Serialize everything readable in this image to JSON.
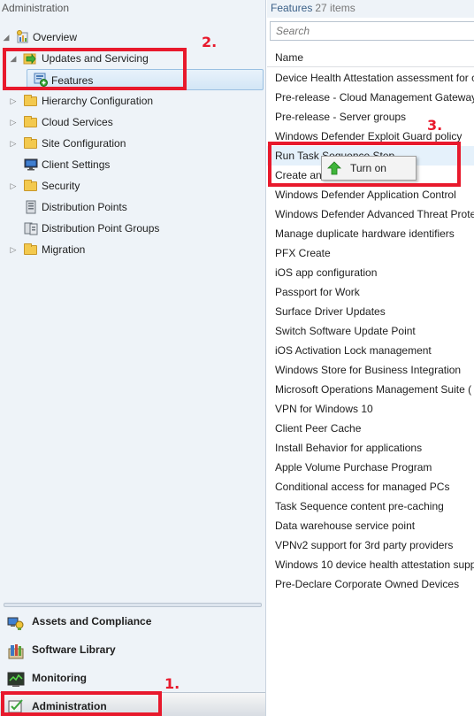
{
  "left_pane": {
    "title": "Administration",
    "tree": [
      {
        "label": "Overview",
        "icon": "overview-icon",
        "expander": "◢"
      },
      {
        "label": "Updates and Servicing",
        "icon": "updates-servicing-icon",
        "expander": "◢"
      },
      {
        "label": "Features",
        "icon": "features-icon",
        "expander": ""
      },
      {
        "label": "Hierarchy Configuration",
        "icon": "folder-icon",
        "expander": "▷"
      },
      {
        "label": "Cloud Services",
        "icon": "folder-icon",
        "expander": "▷"
      },
      {
        "label": "Site Configuration",
        "icon": "folder-icon",
        "expander": "▷"
      },
      {
        "label": "Client Settings",
        "icon": "monitor-icon",
        "expander": ""
      },
      {
        "label": "Security",
        "icon": "folder-icon",
        "expander": "▷"
      },
      {
        "label": "Distribution Points",
        "icon": "distribution-icon",
        "expander": ""
      },
      {
        "label": "Distribution Point Groups",
        "icon": "distribution-icon",
        "expander": ""
      },
      {
        "label": "Migration",
        "icon": "folder-icon",
        "expander": "▷"
      }
    ],
    "workspaces": [
      {
        "label": "Assets and Compliance",
        "icon": "assets-icon"
      },
      {
        "label": "Software Library",
        "icon": "software-library-icon"
      },
      {
        "label": "Monitoring",
        "icon": "monitoring-icon"
      },
      {
        "label": "Administration",
        "icon": "administration-icon"
      }
    ]
  },
  "right_pane": {
    "title": "Features",
    "count": "27 items",
    "search_placeholder": "Search",
    "column_header": "Name",
    "rows": [
      "Device Health Attestation assessment for c",
      "Pre-release - Cloud Management Gateway",
      "Pre-release - Server groups",
      "Windows Defender Exploit Guard policy",
      "Run Task Sequence Step",
      "Create an",
      "Windows Defender Application Control",
      "Windows Defender Advanced Threat Prote",
      "Manage duplicate hardware identifiers",
      "PFX Create",
      "iOS app configuration",
      "Passport for Work",
      "Surface Driver Updates",
      "Switch Software Update Point",
      "iOS Activation Lock management",
      "Windows Store for Business Integration",
      "Microsoft Operations Management Suite (",
      "VPN for Windows 10",
      "Client Peer Cache",
      "Install Behavior for applications",
      "Apple Volume Purchase Program",
      "Conditional access for managed PCs",
      "Task Sequence content pre-caching",
      "Data warehouse service point",
      "VPNv2 support for 3rd party providers",
      "Windows 10 device health attestation supp",
      "Pre-Declare Corporate Owned Devices"
    ]
  },
  "context_menu": {
    "label": "Turn on",
    "icon": "turn-on-arrow-icon"
  },
  "annotations": {
    "step1": "1.",
    "step2": "2.",
    "step3": "3.",
    "color": "#e8192c"
  }
}
